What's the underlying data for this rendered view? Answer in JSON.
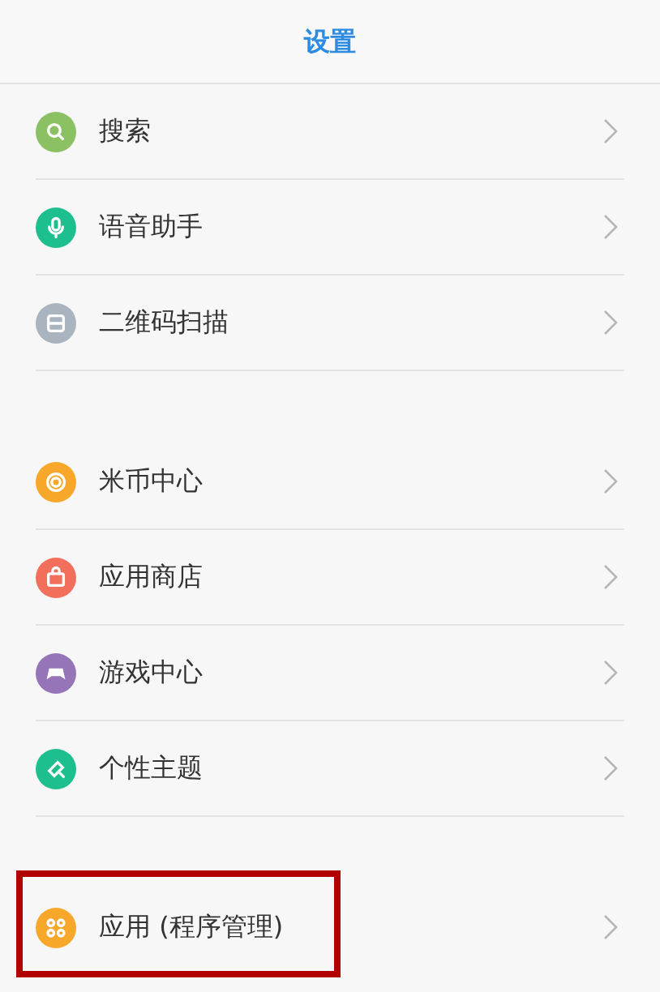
{
  "header": {
    "title": "设置"
  },
  "groups": [
    {
      "items": [
        {
          "label": "搜索",
          "color": "#8cc163",
          "highlighted": false
        },
        {
          "label": "语音助手",
          "color": "#1dbf8e",
          "highlighted": false
        },
        {
          "label": "二维码扫描",
          "color": "#a9b4be",
          "highlighted": false
        }
      ]
    },
    {
      "items": [
        {
          "label": "米币中心",
          "color": "#f7a72a",
          "highlighted": false
        },
        {
          "label": "应用商店",
          "color": "#f26f5c",
          "highlighted": false
        },
        {
          "label": "游戏中心",
          "color": "#9674b8",
          "highlighted": false
        },
        {
          "label": "个性主题",
          "color": "#1dbf8e",
          "highlighted": false
        }
      ]
    },
    {
      "items": [
        {
          "label": "应用 (程序管理)",
          "color": "#f7a72a",
          "highlighted": true
        }
      ]
    }
  ]
}
